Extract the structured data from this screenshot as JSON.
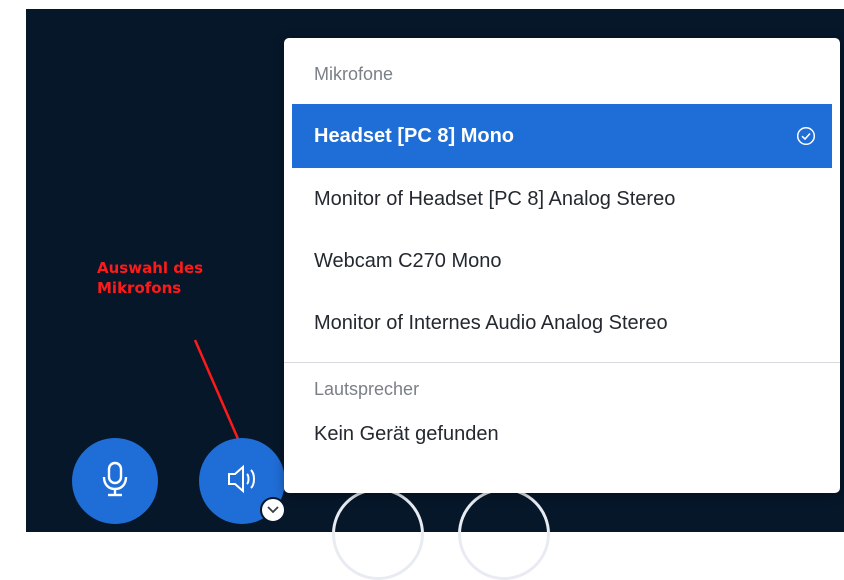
{
  "annotation": {
    "text": "Auswahl des\nMikrofons",
    "color": "#ff1a1a"
  },
  "toolbar": {
    "mic_icon": "microphone-icon",
    "speaker_icon": "speaker-icon",
    "accent": "#1f6dd6",
    "background": "#06172a"
  },
  "menu": {
    "microphones_header": "Mikrofone",
    "microphones": [
      {
        "label": "Headset [PC 8] Mono",
        "selected": true
      },
      {
        "label": "Monitor of Headset [PC 8] Analog Stereo",
        "selected": false
      },
      {
        "label": "Webcam C270 Mono",
        "selected": false
      },
      {
        "label": "Monitor of Internes Audio Analog Stereo",
        "selected": false
      }
    ],
    "speakers_header": "Lautsprecher",
    "speakers": [
      {
        "label": "Kein Gerät gefunden",
        "selected": false
      }
    ]
  }
}
